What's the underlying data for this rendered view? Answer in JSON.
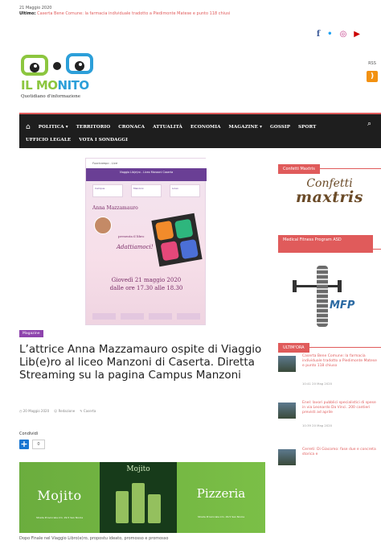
{
  "topbar": {
    "date": "21 Maggio 2020",
    "ultimo_label": "Ultimo:",
    "ultimo_text": "Caserta Bene Comune: la farmacia individuale tradotto a Piedimonte Matese e punto 118 chiusi"
  },
  "socials": {
    "facebook": "f",
    "twitter": "•",
    "instagram": "◎",
    "youtube": "▶"
  },
  "logo": {
    "name_a": "IL MO",
    "name_b": "NITO",
    "tagline": "Quotidiano d'informazione"
  },
  "rss": {
    "label": "RSS",
    "glyph": ")"
  },
  "nav": {
    "row1": [
      "POLITICA ▾",
      "TERRITORIO",
      "CRONACA",
      "ATTUALITÀ",
      "ECONOMIA",
      "MAGAZINE ▾",
      "GOSSIP",
      "SPORT"
    ],
    "row2": [
      "UFFICIO LEGALE",
      "VOTA I SONDAGGI"
    ],
    "home_glyph": "⌂",
    "search_glyph": "⌕"
  },
  "hero": {
    "top_text": "Fuoricampo - Live",
    "band_text": "Viaggio Lib(e)ro - Liceo Manzoni Caserta",
    "logo_a": "Campus",
    "logo_b": "Manzoni",
    "logo_c": "Liceo",
    "who": "Anna Mazzamauro",
    "incontra": "presenta il libro",
    "booktitle": "Adattiamoci!",
    "when_1": "Giovedì 21 maggio 2020",
    "when_2": "dalle ore 17.30 alle 18.30"
  },
  "article": {
    "category": "Magazine",
    "title": "L’attrice Anna Mazzamauro ospite di Viaggio Lib(e)ro al liceo Manzoni di Caserta. Diretta Streaming su la pagina Campus Manzoni",
    "meta_date": "◷ 20 Maggio 2020",
    "meta_author": "☺ Redazione",
    "meta_tag": "✎ Caserta",
    "share_label": "Condividi",
    "share_count": "0",
    "plus_glyph": "+"
  },
  "ad": {
    "left_brand": "Mojito",
    "left_addr": "Strada Provinciale km. 29.5 San Nicola",
    "mid_brand": "Mojito",
    "right_brand": "Pizzeria",
    "right_addr": "Strada Provinciale km. 29.5 San Nicola"
  },
  "caption": "Dopo Finale nel Viaggio Libro(e)ro, propostu ideato, promosso e promosso",
  "sidebar": {
    "w1_title": "Confetti Maxtris",
    "w1_logo_a": "Confetti",
    "w1_logo_b": "maxtris",
    "w2_title": "Medical Fitness Program ASD",
    "w2_logo": "MFP",
    "w3_title": "ULTIM'ORA",
    "news": [
      {
        "title": "Caserta Bene Comune: la farmacia individuale tradotto a Piedimonte Matese e punto 118 chiuso",
        "date": "10:41 20 Mag 2020"
      },
      {
        "title": "Enel: lavori pubblici specialistici di spese in via Leonardo Da Vinci. 200 cantieri previsti ad aprile",
        "date": "10:39 20 Mag 2020"
      },
      {
        "title": "Cerreti: Di Giacomo: fase due e concreta storica e",
        "date": ""
      }
    ]
  }
}
